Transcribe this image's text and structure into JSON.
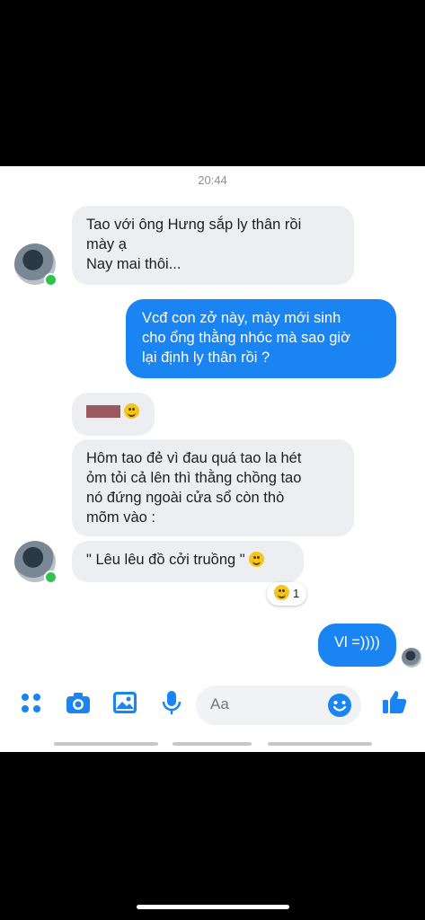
{
  "timestamp": "20:44",
  "messages": [
    {
      "side": "in",
      "text": "Tao với ông Hưng sắp ly thân rồi\nmày ạ\nNay mai thôi..."
    },
    {
      "side": "out",
      "text": "Vcđ con zở này, mày mới sinh\ncho ổng thằng nhóc mà sao giờ\nlại định ly thân rồi ?"
    },
    {
      "side": "in",
      "text": ""
    },
    {
      "side": "in",
      "text": "Hôm tao đẻ vì đau quá tao la hét\nỏm tỏi cả lên thì thằng chồng tao\nnó đứng ngoài cửa sổ còn thò\nmõm vào :"
    },
    {
      "side": "in",
      "text": "\" Lêu lêu đồ cởi truồng \""
    },
    {
      "side": "out",
      "text": "Vl =))))"
    }
  ],
  "reaction": {
    "icon": "laughing-emoji",
    "count": "1"
  },
  "composer": {
    "placeholder": "Aa"
  },
  "toolbar_icons": [
    "more-apps-icon",
    "camera-icon",
    "gallery-icon",
    "microphone-icon",
    "emoji-icon",
    "like-icon"
  ],
  "colors": {
    "accent": "#1a84f2",
    "incoming_bubble": "#eceef1",
    "online": "#31c24d"
  }
}
